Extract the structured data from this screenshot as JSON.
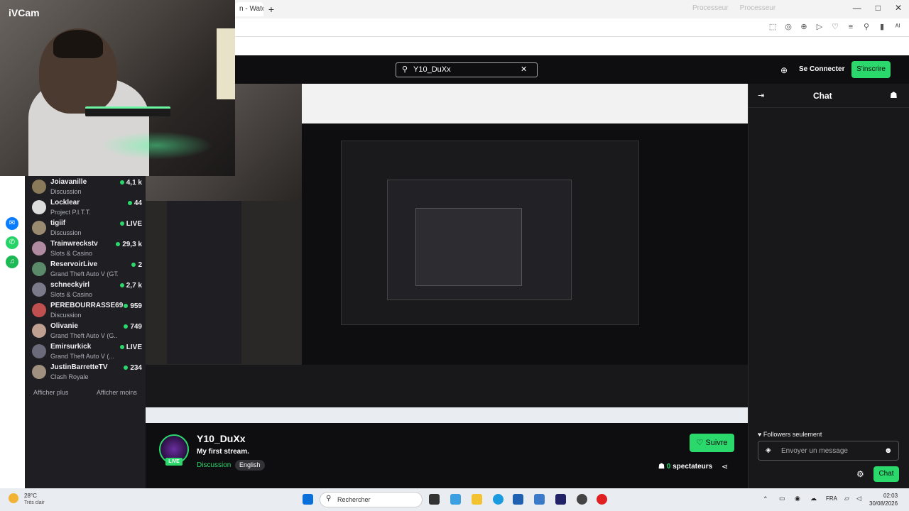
{
  "browser": {
    "tab_label": "n - Watch",
    "new_tab": "+",
    "perf_labels": [
      "Processeur",
      "Processeur"
    ],
    "window_controls": [
      "—",
      "□",
      "✕"
    ],
    "extension_icons": [
      "⬚",
      "◎",
      "⊕",
      "▷",
      "♡",
      "≡",
      "⚲",
      "▮",
      "ᴬᴵ"
    ]
  },
  "webcam": {
    "label": "iVCam"
  },
  "header": {
    "search_value": "Y10_DuXx",
    "search_icon": "search-icon",
    "clear_icon": "close-icon",
    "globe_icon": "globe-icon",
    "login_label": "Se Connecter",
    "signup_label": "S'inscrire"
  },
  "recommended": {
    "items": [
      {
        "name": "Joiavanille",
        "category": "Discussion",
        "viewers": "4,1 k",
        "live": false
      },
      {
        "name": "Locklear",
        "category": "Project P.I.T.T.",
        "viewers": "44",
        "live": false
      },
      {
        "name": "tigiif",
        "category": "Discussion",
        "viewers": "LIVE",
        "live": true
      },
      {
        "name": "Trainwreckstv",
        "category": "Slots & Casino",
        "viewers": "29,3 k",
        "live": false
      },
      {
        "name": "ReservoirLive",
        "category": "Grand Theft Auto V (GTA)",
        "viewers": "2",
        "live": false
      },
      {
        "name": "schneckyirl",
        "category": "Slots & Casino",
        "viewers": "2,7 k",
        "live": false
      },
      {
        "name": "PEREBOURRASSE69",
        "category": "Discussion",
        "viewers": "959",
        "live": false
      },
      {
        "name": "Olivanie",
        "category": "Grand Theft Auto V (G...",
        "viewers": "749",
        "live": false
      },
      {
        "name": "Emirsurkick",
        "category": "Grand Theft Auto V (...",
        "viewers": "LIVE",
        "live": true
      },
      {
        "name": "JustinBarretteTV",
        "category": "Clash Royale",
        "viewers": "234",
        "live": false
      }
    ],
    "show_more": "Afficher plus",
    "show_less": "Afficher moins"
  },
  "chat": {
    "title": "Chat",
    "followers_only": "Followers seulement",
    "input_placeholder": "Envoyer un message",
    "send_label": "Chat"
  },
  "stream": {
    "channel_name": "Y10_DuXx",
    "title": "My first stream.",
    "category": "Discussion",
    "language": "English",
    "live_badge": "LIVE",
    "follow_label": "Suivre",
    "viewer_count": "0",
    "viewer_label": "spectateurs"
  },
  "taskbar": {
    "weather_temp": "28°C",
    "weather_desc": "Très clair",
    "search_placeholder": "Rechercher",
    "lang": "FRA",
    "time": "02:03",
    "date": "30/08/2026"
  },
  "colors": {
    "accent": "#2bd86c",
    "bg": "#0e0e10",
    "panel": "#18181b"
  }
}
